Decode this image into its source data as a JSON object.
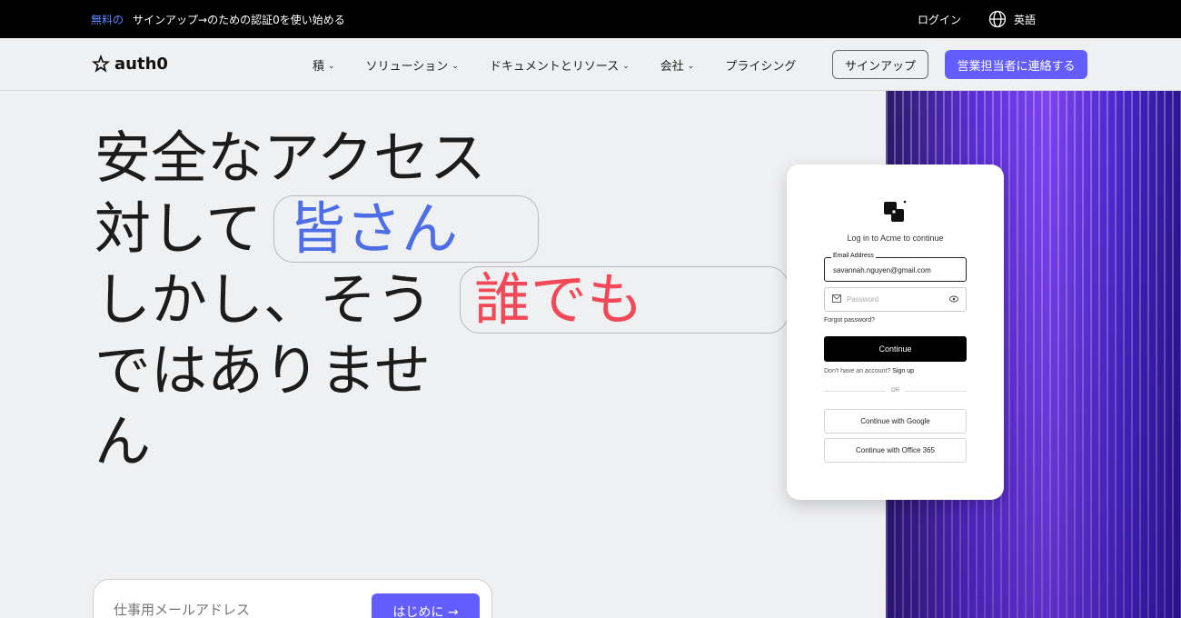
{
  "topbar": {
    "free_label": "無料の",
    "promo_text": "サインアップ→のための認証0を使い始める",
    "login": "ログイン",
    "language": "英語"
  },
  "nav": {
    "logo_text": "auth0",
    "items": [
      {
        "label": "積",
        "dropdown": true
      },
      {
        "label": "ソリューション",
        "dropdown": true
      },
      {
        "label": "ドキュメントとリソース",
        "dropdown": true
      },
      {
        "label": "会社",
        "dropdown": true
      },
      {
        "label": "プライシング",
        "dropdown": false
      }
    ],
    "signup": "サインアップ",
    "contact": "営業担当者に連絡する"
  },
  "hero": {
    "line1": "安全なアクセス",
    "line2": "対して",
    "line2_highlight": "皆さん",
    "line3": "しかし、そう",
    "line3_highlight": "誰でも",
    "line4": "ではありませ",
    "line5": "ん"
  },
  "email_signup": {
    "placeholder": "仕事用メールアドレス",
    "button": "はじめに →"
  },
  "login_card": {
    "title": "Log in to Acme to continue",
    "email_label": "Email Address",
    "email_value": "savannah.nguyen@gmail.com",
    "password_placeholder": "Password",
    "forgot": "Forgot password?",
    "continue": "Continue",
    "no_account": "Don't have an account?",
    "sign_up": "Sign up",
    "or": "OR",
    "google": "Continue with Google",
    "office": "Continue with Office 365"
  },
  "colors": {
    "accent": "#635dff",
    "highlight_blue": "#4e6ee8",
    "highlight_red": "#f24959"
  }
}
